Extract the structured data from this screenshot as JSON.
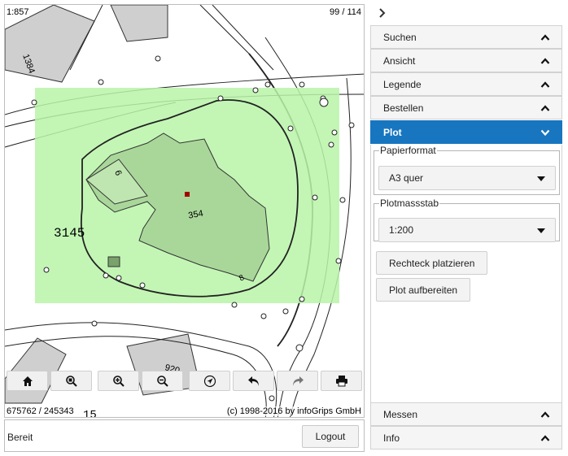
{
  "map": {
    "scale": "1:857",
    "page": "99 / 114",
    "coordinates": "675762 / 245343",
    "copyright": "(c) 1998-2016 by infoGrips GmbH",
    "labels": {
      "parcel": "3145",
      "building_small": "354",
      "plot_num_top": "1384",
      "label_6": "6",
      "label_920": "920",
      "label_15": "15",
      "label_8": "8"
    },
    "toolbar": [
      {
        "name": "home-icon"
      },
      {
        "name": "zoom-extent-icon"
      },
      {
        "name": "zoom-in-icon"
      },
      {
        "name": "zoom-out-icon"
      },
      {
        "name": "locate-icon"
      },
      {
        "name": "undo-icon"
      },
      {
        "name": "redo-icon"
      },
      {
        "name": "print-icon"
      }
    ],
    "colors": {
      "print_area": "#b9f5a8",
      "building": "#a9d79a",
      "marker": "#a30000"
    }
  },
  "status": {
    "text": "Bereit",
    "logout_label": "Logout"
  },
  "panel": {
    "sections": [
      {
        "label": "Suchen",
        "icon": "chevron-up-icon"
      },
      {
        "label": "Ansicht",
        "icon": "chevron-up-icon"
      },
      {
        "label": "Legende",
        "icon": "chevron-up-icon"
      },
      {
        "label": "Bestellen",
        "icon": "chevron-up-icon"
      },
      {
        "label": "Plot",
        "icon": "chevron-down-icon",
        "active": true
      }
    ],
    "plot": {
      "paper_legend": "Papierformat",
      "paper_value": "A3 quer",
      "scale_legend": "Plotmassstab",
      "scale_value": "1:200",
      "place_button": "Rechteck platzieren",
      "prepare_button": "Plot aufbereiten"
    },
    "bottom_sections": [
      {
        "label": "Messen",
        "icon": "chevron-up-icon"
      },
      {
        "label": "Info",
        "icon": "chevron-up-icon"
      }
    ],
    "accent": "#1876c0"
  }
}
